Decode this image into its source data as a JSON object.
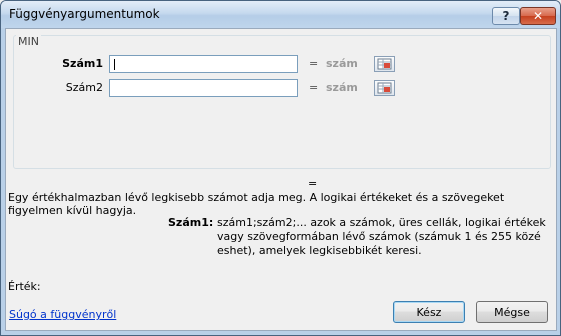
{
  "window": {
    "title": "Függvényargumentumok",
    "help_glyph": "?",
    "close_glyph": "✕"
  },
  "function_group": {
    "name": "MIN",
    "args": [
      {
        "label": "Szám1",
        "value": "",
        "result_eq": "=",
        "result": "szám"
      },
      {
        "label": "Szám2",
        "value": "",
        "result_eq": "=",
        "result": "szám"
      }
    ]
  },
  "formula_result_eq": "=",
  "description": "Egy értékhalmazban lévő legkisebb számot adja meg. A logikai értékeket és a szövegeket figyelmen kívül hagyja.",
  "arg_help": {
    "name": "Szám1:",
    "text": "szám1;szám2;... azok a számok, üres cellák, logikai értékek vagy szövegformában lévő számok (számuk 1 és 255 közé eshet), amelyek legkisebbikét keresi."
  },
  "value_label": "Érték:",
  "help_link": "Súgó a függvényről",
  "buttons": {
    "ok": "Kész",
    "cancel": "Mégse"
  },
  "icons": {
    "ref_button": "collapse-dialog-icon"
  }
}
